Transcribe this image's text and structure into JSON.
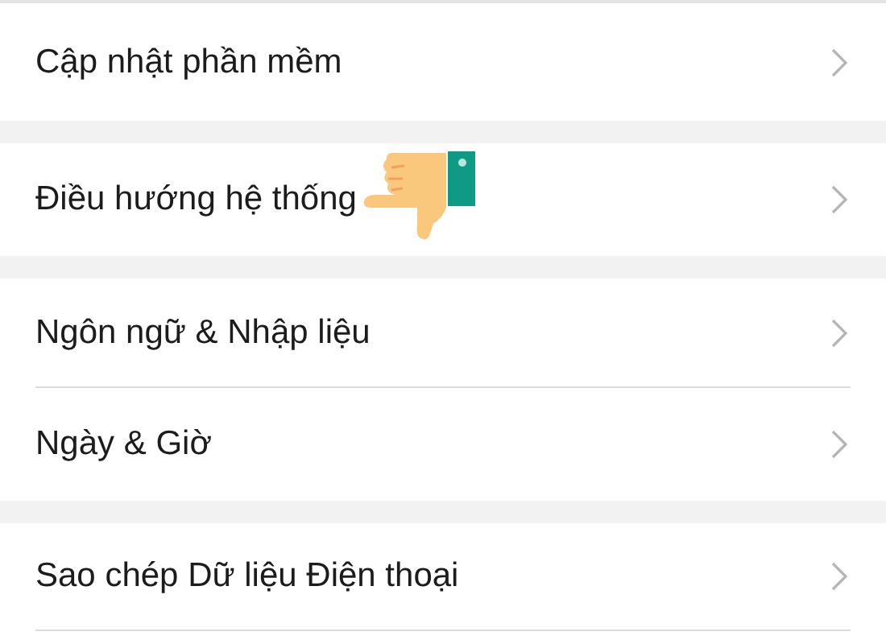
{
  "sections": [
    {
      "items": [
        {
          "label": "Cập nhật phần mềm",
          "pointer": false
        }
      ]
    },
    {
      "items": [
        {
          "label": "Điều hướng hệ thống",
          "pointer": true
        }
      ]
    },
    {
      "items": [
        {
          "label": "Ngôn ngữ & Nhập liệu",
          "pointer": false
        },
        {
          "label": "Ngày & Giờ",
          "pointer": false
        }
      ]
    },
    {
      "items": [
        {
          "label": "Sao chép Dữ liệu Điện thoại",
          "pointer": false
        }
      ]
    }
  ]
}
